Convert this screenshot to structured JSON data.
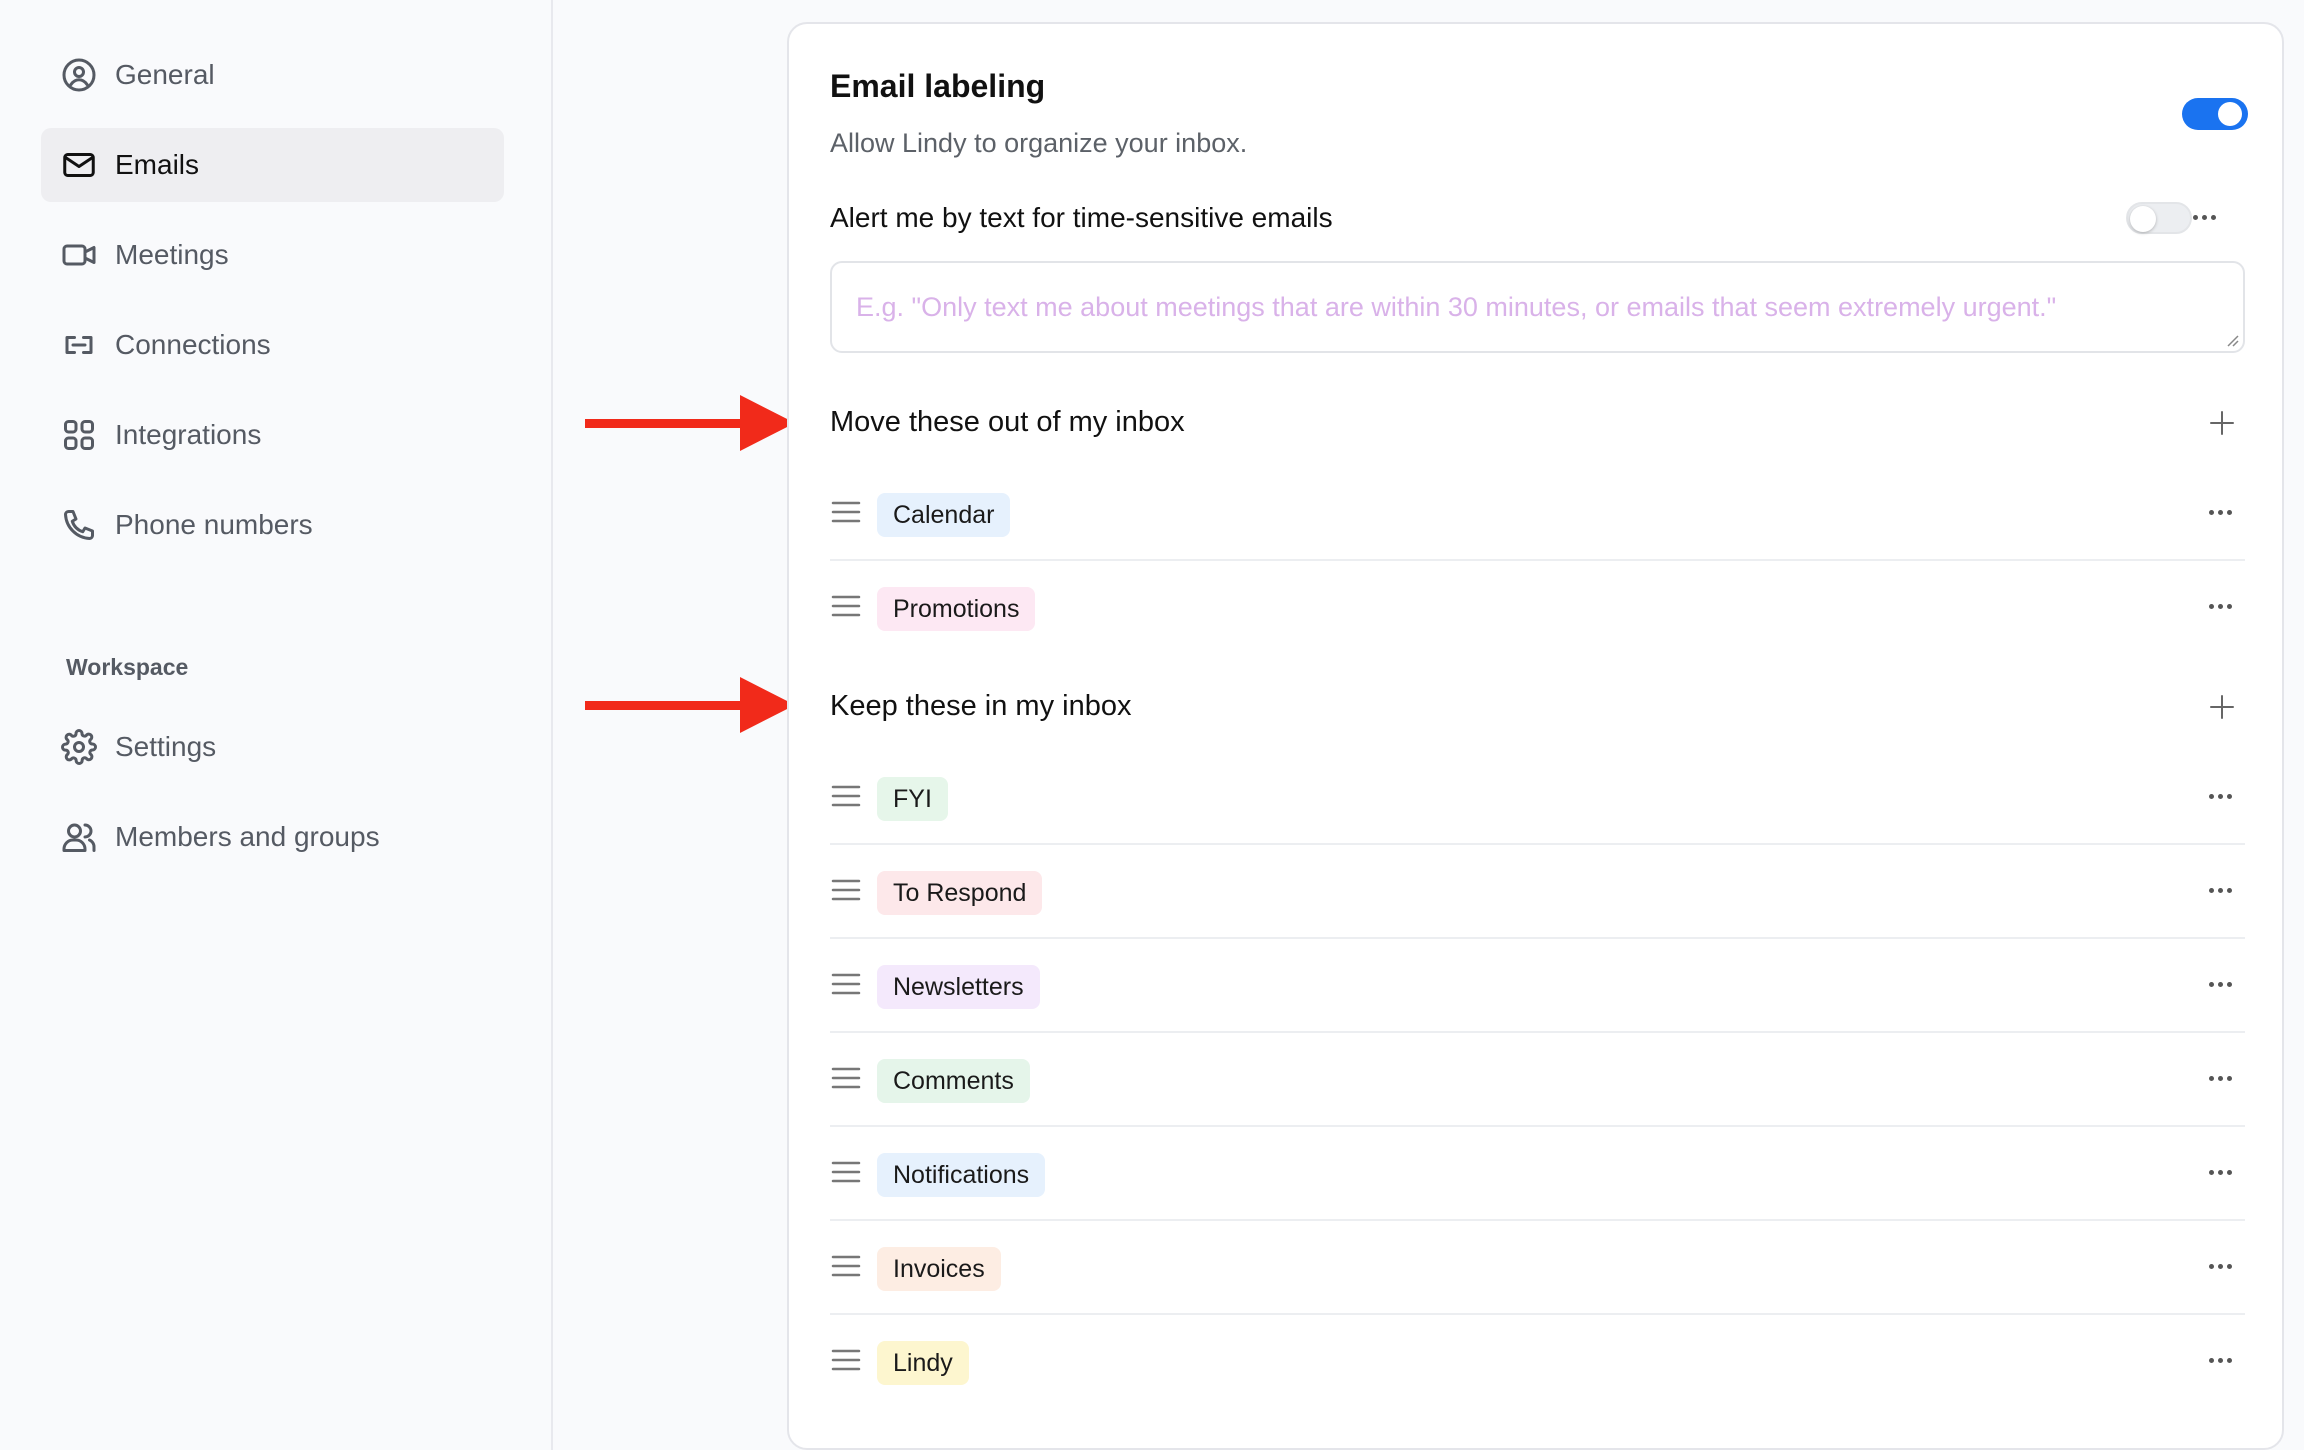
{
  "sidebar": {
    "items": [
      {
        "label": "General",
        "icon": "user-circle-icon"
      },
      {
        "label": "Emails",
        "icon": "mail-icon"
      },
      {
        "label": "Meetings",
        "icon": "video-icon"
      },
      {
        "label": "Connections",
        "icon": "link-icon"
      },
      {
        "label": "Integrations",
        "icon": "grid-icon"
      },
      {
        "label": "Phone numbers",
        "icon": "phone-icon"
      }
    ],
    "active": "Emails",
    "workspace_label": "Workspace",
    "workspace_items": [
      {
        "label": "Settings",
        "icon": "gear-icon"
      },
      {
        "label": "Members and groups",
        "icon": "users-icon"
      }
    ]
  },
  "main": {
    "title": "Email labeling",
    "subtitle": "Allow Lindy to organize your inbox.",
    "labeling_enabled": true,
    "alert_label": "Alert me by text for time-sensitive emails",
    "alert_enabled": false,
    "alert_placeholder": "E.g. \"Only text me about meetings that are within 30 minutes, or emails that seem extremely urgent.\"",
    "move_out_title": "Move these out of my inbox",
    "move_out_labels": [
      {
        "label": "Calendar",
        "color": "#e6f1fd"
      },
      {
        "label": "Promotions",
        "color": "#fde8f3"
      }
    ],
    "keep_title": "Keep these in my inbox",
    "keep_labels": [
      {
        "label": "FYI",
        "color": "#e6f6ea"
      },
      {
        "label": "To Respond",
        "color": "#fde8ea"
      },
      {
        "label": "Newsletters",
        "color": "#f4e9fc"
      },
      {
        "label": "Comments",
        "color": "#e5f5ea"
      },
      {
        "label": "Notifications",
        "color": "#e6f1fd"
      },
      {
        "label": "Invoices",
        "color": "#fdede3"
      },
      {
        "label": "Lindy",
        "color": "#fdf6cf"
      }
    ]
  },
  "colors": {
    "accent": "#1a73f0",
    "annotation_arrow": "#f12a1a"
  }
}
